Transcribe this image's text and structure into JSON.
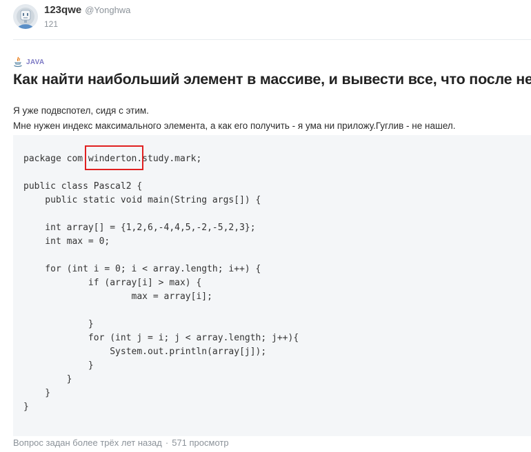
{
  "author": {
    "name": "123qwe",
    "nickname": "@Yonghwa",
    "rating": "121"
  },
  "tag": {
    "label": "JAVA",
    "icon": "java-icon"
  },
  "question": {
    "title": "Как найти наибольший элемент в массиве, и вывести все, что после него?",
    "paragraphs": [
      "Я уже подвспотел, сидя с этим.",
      "Мне нужен индекс максимального элемента, а как его получить - я ума ни приложу.Гуглив - не нашел."
    ],
    "code_lines": [
      "package com.winderton.study.mark;",
      "",
      "public class Pascal2 {",
      "    public static void main(String args[]) {",
      "",
      "    int array[] = {1,2,6,-4,4,5,-2,-5,2,3};",
      "    int max = 0;",
      "",
      "    for (int i = 0; i < array.length; i++) {",
      "            if (array[i] > max) {",
      "                    max = array[i];",
      "",
      "            }",
      "            for (int j = i; j < array.length; j++){",
      "                System.out.println(array[j]);",
      "            }",
      "        }",
      "    }",
      "}"
    ],
    "highlight_color": "#e02020"
  },
  "footer": {
    "asked": "Вопрос задан более трёх лет назад",
    "separator": "·",
    "views": "571 просмотр"
  },
  "colors": {
    "tag": "#7c78c4",
    "code_background": "#f4f6f8",
    "muted_text": "#8b9299"
  }
}
